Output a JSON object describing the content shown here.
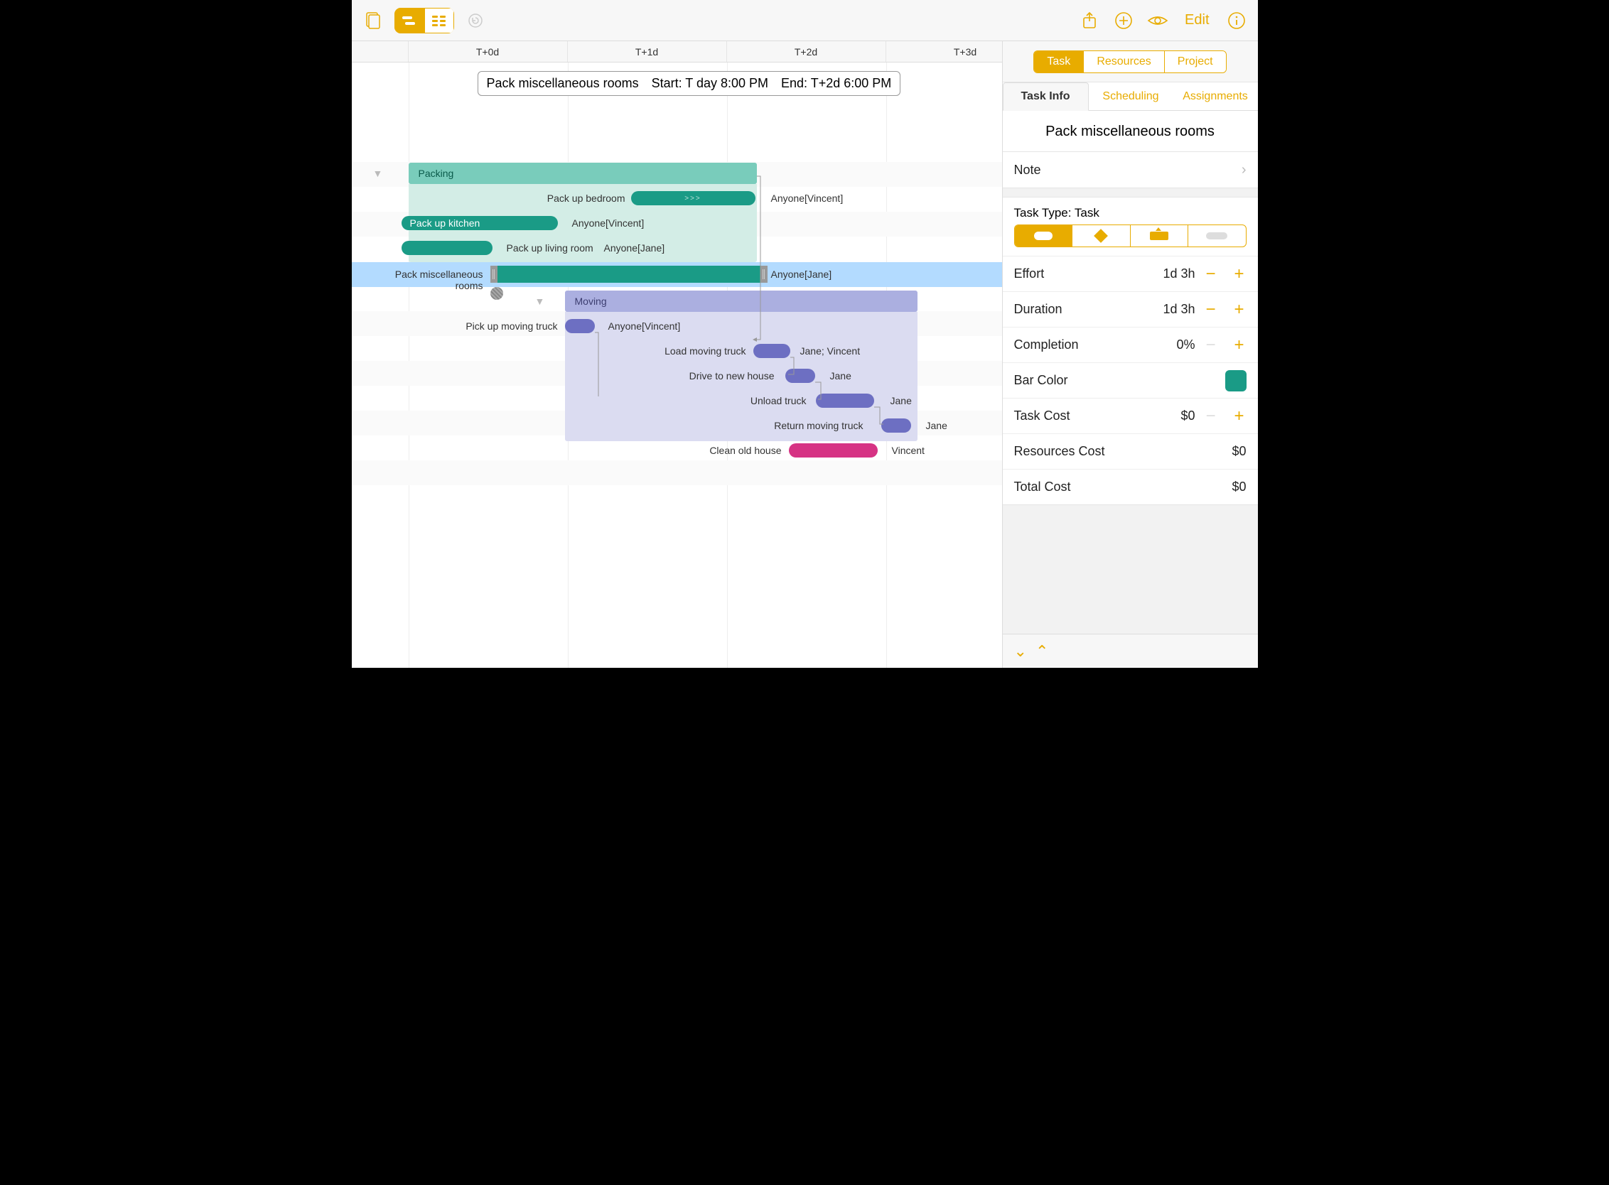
{
  "colors": {
    "accent": "#e8ac00",
    "teal": "#1a9b86",
    "tealLight": "#b8e0d7",
    "purple": "#6d6fc2",
    "purpleLight": "#cbcdea",
    "magenta": "#d63384"
  },
  "toolbar": {
    "edit": "Edit"
  },
  "dayHeaders": [
    "T+0d",
    "T+1d",
    "T+2d",
    "T+3d"
  ],
  "tooltip": {
    "title": "Pack miscellaneous rooms",
    "start": "Start: T day 8:00 PM",
    "end": "End: T+2d 6:00 PM"
  },
  "groups": {
    "packing": {
      "label": "Packing"
    },
    "moving": {
      "label": "Moving"
    }
  },
  "tasks": [
    {
      "name": "Pack up bedroom",
      "res": "Anyone[Vincent]"
    },
    {
      "name": "Pack up kitchen",
      "res": "Anyone[Vincent]"
    },
    {
      "name": "Pack up living room",
      "res": "Anyone[Jane]"
    },
    {
      "name": "Pack miscellaneous rooms",
      "res": "Anyone[Jane]"
    },
    {
      "name": "Pick up moving truck",
      "res": "Anyone[Vincent]"
    },
    {
      "name": "Load moving truck",
      "res": "Jane; Vincent"
    },
    {
      "name": "Drive to new house",
      "res": "Jane"
    },
    {
      "name": "Unload truck",
      "res": "Jane"
    },
    {
      "name": "Return moving truck",
      "res": "Jane"
    },
    {
      "name": "Clean old house",
      "res": "Vincent"
    }
  ],
  "inspector": {
    "tabsTop": {
      "task": "Task",
      "resources": "Resources",
      "project": "Project"
    },
    "tabsSub": {
      "info": "Task Info",
      "scheduling": "Scheduling",
      "assignments": "Assignments"
    },
    "title": "Pack miscellaneous rooms",
    "note": "Note",
    "taskTypeLabel": "Task Type: Task",
    "effort": {
      "label": "Effort",
      "value": "1d 3h"
    },
    "duration": {
      "label": "Duration",
      "value": "1d 3h"
    },
    "completion": {
      "label": "Completion",
      "value": "0%"
    },
    "barColor": {
      "label": "Bar Color"
    },
    "taskCost": {
      "label": "Task Cost",
      "value": "$0"
    },
    "resourcesCost": {
      "label": "Resources Cost",
      "value": "$0"
    },
    "totalCost": {
      "label": "Total Cost",
      "value": "$0"
    }
  }
}
